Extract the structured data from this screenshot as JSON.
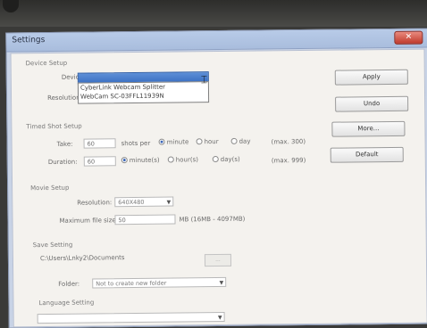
{
  "window": {
    "title": "Settings",
    "close_symbol": "✕"
  },
  "device_setup": {
    "section_label": "Device Setup",
    "device_label": "Device:",
    "resolution_label": "Resolution:",
    "device_options": [
      "CyberLink Webcam Splitter",
      "WebCam SC-03FFL11939N"
    ]
  },
  "buttons": {
    "apply": "Apply",
    "undo": "Undo",
    "more": "More...",
    "default": "Default"
  },
  "timed_shot": {
    "section_label": "Timed Shot Setup",
    "take_label": "Take:",
    "take_value": "60",
    "shots_per_label": "shots per",
    "take_units": [
      "minute",
      "hour",
      "day"
    ],
    "take_max": "(max. 300)",
    "duration_label": "Duration:",
    "duration_value": "60",
    "duration_units": [
      "minute(s)",
      "hour(s)",
      "day(s)"
    ],
    "duration_max": "(max. 999)"
  },
  "movie_setup": {
    "section_label": "Movie Setup",
    "resolution_label": "Resolution:",
    "resolution_value": "640X480",
    "max_file_size_label": "Maximum file size:",
    "max_file_size_value": "50",
    "max_file_size_range": "MB (16MB - 4097MB)"
  },
  "save_setting": {
    "section_label": "Save Setting",
    "path": "C:\\Users\\Lnky2\\Documents",
    "browse_label": "...",
    "folder_label": "Folder:",
    "folder_value": "Not to create new folder"
  },
  "language_setting": {
    "section_label": "Language Setting"
  }
}
